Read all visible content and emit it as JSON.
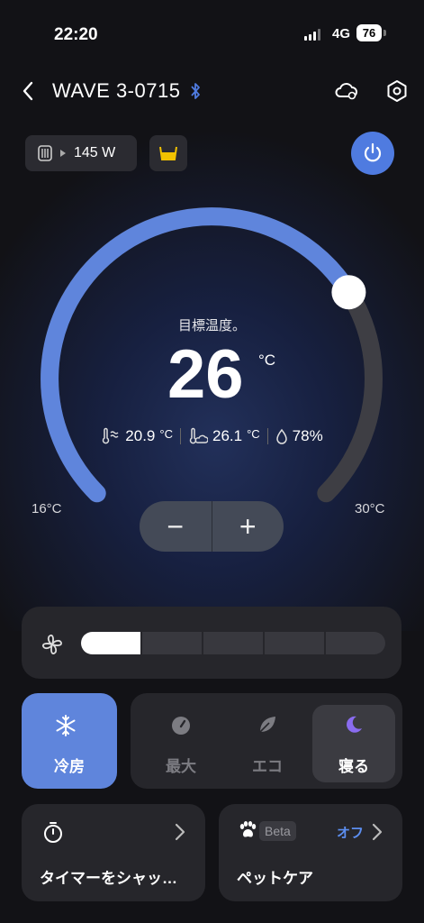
{
  "status_bar": {
    "time": "22:20",
    "network": "4G",
    "battery": "76"
  },
  "header": {
    "title": "WAVE 3-0715"
  },
  "power_chip": {
    "value": "145 W"
  },
  "dial": {
    "label": "目標温度。",
    "target_temp": "26",
    "unit": "°C",
    "min_label": "16°C",
    "max_label": "30°C",
    "min": 16,
    "max": 30,
    "value": 26
  },
  "readings": {
    "ambient": "20.9",
    "feels": "26.1",
    "humidity": "78%",
    "unit": "°C"
  },
  "stepper": {
    "minus": "−",
    "plus": "+"
  },
  "fan": {
    "level": 1,
    "levels": 5
  },
  "modes": {
    "cool": "冷房",
    "max": "最大",
    "eco": "エコ",
    "sleep": "寝る"
  },
  "cards": {
    "timer": "タイマーをシャッ…",
    "pet": "ペットケア",
    "beta": "Beta",
    "off": "オフ"
  },
  "colors": {
    "accent": "#5f85dc",
    "track": "#3e3e44",
    "fan_on": "#ffffff"
  }
}
